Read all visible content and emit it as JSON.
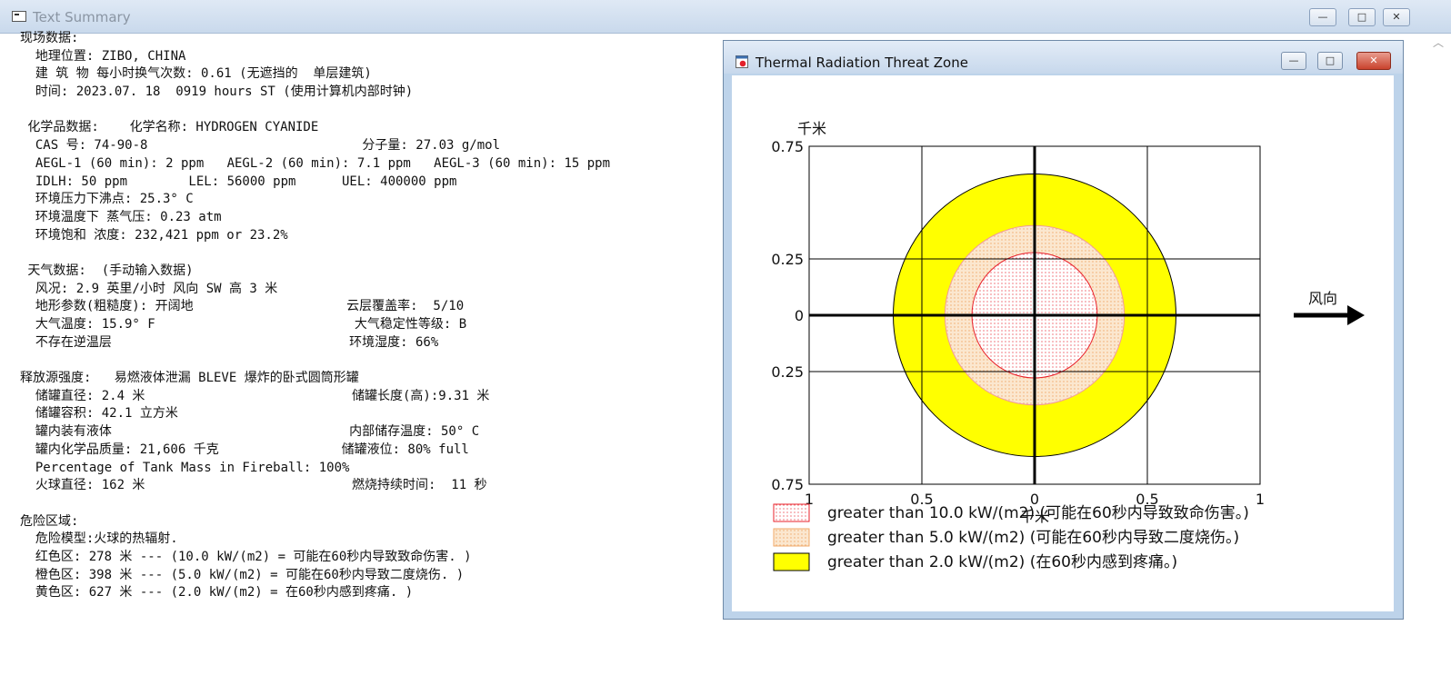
{
  "window": {
    "title": "Text Summary",
    "minimize_label": "—",
    "maximize_label": "□",
    "close_label": "✕"
  },
  "summary_lines": [
    "现场数据:",
    "  地理位置: ZIBO, CHINA",
    "  建 筑 物 每小时换气次数: 0.61 (无遮挡的  单层建筑)",
    "  时间: 2023.07. 18  0919 hours ST (使用计算机内部时钟)",
    "",
    " 化学品数据:    化学名称: HYDROGEN CYANIDE",
    "  CAS 号: 74-90-8                            分子量: 27.03 g/mol",
    "  AEGL-1 (60 min): 2 ppm   AEGL-2 (60 min): 7.1 ppm   AEGL-3 (60 min): 15 ppm",
    "  IDLH: 50 ppm        LEL: 56000 ppm      UEL: 400000 ppm",
    "  环境压力下沸点: 25.3° C",
    "  环境温度下 蒸气压: 0.23 atm",
    "  环境饱和 浓度: 232,421 ppm or 23.2%",
    "",
    " 天气数据:  (手动输入数据)",
    "  风况: 2.9 英里/小时 风向 SW 高 3 米",
    "  地形参数(粗糙度): 开阔地                    云层覆盖率:  5/10",
    "  大气温度: 15.9° F                          大气稳定性等级: B",
    "  不存在逆温层                               环境湿度: 66%",
    "",
    "释放源强度:   易燃液体泄漏 BLEVE 爆炸的卧式圆筒形罐",
    "  储罐直径: 2.4 米                           储罐长度(高):9.31 米",
    "  储罐容积: 42.1 立方米",
    "  罐内装有液体                               内部储存温度: 50° C",
    "  罐内化学品质量: 21,606 千克                储罐液位: 80% full",
    "  Percentage of Tank Mass in Fireball: 100%",
    "  火球直径: 162 米                           燃烧持续时间:  11 秒",
    "",
    "危险区域:",
    "  危险模型:火球的热辐射.",
    "  红色区: 278 米 --- (10.0 kW/(m2) = 可能在60秒内导致致命伤害. )",
    "  橙色区: 398 米 --- (5.0 kW/(m2) = 可能在60秒内导致二度烧伤. )",
    "  黄色区: 627 米 --- (2.0 kW/(m2) = 在60秒内感到疼痛. )"
  ],
  "threat_window": {
    "title": "Thermal Radiation Threat Zone",
    "minimize_label": "—",
    "maximize_label": "□",
    "close_label": "✕"
  },
  "colors": {
    "red_zone": "#e8202a",
    "orange_zone": "#f6d2a8",
    "yellow_zone": "#ffff00"
  },
  "chart_data": {
    "type": "area",
    "y_unit": "千米",
    "x_unit": "千米",
    "y_ticks": [
      {
        "value": 0.75,
        "label": "0.75"
      },
      {
        "value": 0.25,
        "label": "0.25"
      },
      {
        "value": 0,
        "label": "0"
      },
      {
        "value": -0.25,
        "label": "0.25"
      },
      {
        "value": -0.75,
        "label": "0.75"
      }
    ],
    "x_ticks": [
      {
        "value": -1,
        "label": "1"
      },
      {
        "value": -0.5,
        "label": "0.5"
      },
      {
        "value": 0,
        "label": "0"
      },
      {
        "value": 0.5,
        "label": "0.5"
      },
      {
        "value": 1,
        "label": "1"
      }
    ],
    "xlim": [
      -1,
      1
    ],
    "ylim": [
      -0.75,
      0.75
    ],
    "grid": true,
    "wind_label": "风向",
    "zones": [
      {
        "name": "yellow",
        "radius_km": 0.627,
        "label": "greater than 2.0 kW/(m2) (在60秒内感到疼痛。)"
      },
      {
        "name": "orange",
        "radius_km": 0.398,
        "label": "greater than 5.0 kW/(m2) (可能在60秒内导致二度烧伤。)"
      },
      {
        "name": "red",
        "radius_km": 0.278,
        "label": "greater than 10.0 kW/(m2) (可能在60秒内导致致命伤害。)"
      }
    ]
  }
}
